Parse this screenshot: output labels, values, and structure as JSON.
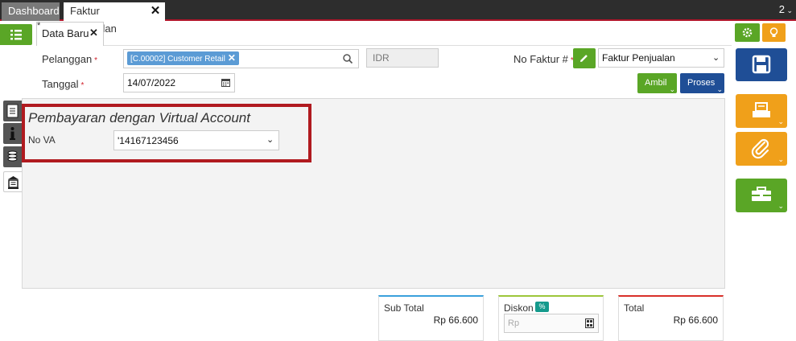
{
  "window": {
    "count": "2"
  },
  "tabs": [
    {
      "label": "Dashboard"
    },
    {
      "label": "Faktur Penjualan"
    }
  ],
  "subtab": {
    "label": "Data Baru",
    "modified_marker": "*"
  },
  "form": {
    "pelanggan_label": "Pelanggan",
    "pelanggan_value": "[C.00002] Customer Retail",
    "currency": "IDR",
    "tanggal_label": "Tanggal",
    "tanggal_value": "14/07/2022",
    "required_marker": "*",
    "no_faktur_label": "No Faktur #",
    "faktur_type": "Faktur Penjualan"
  },
  "actions": {
    "ambil": "Ambil",
    "proses": "Proses"
  },
  "va": {
    "title": "Pembayaran dengan Virtual Account",
    "label": "No VA",
    "value": "'14167123456"
  },
  "totals": {
    "subtotal_label": "Sub Total",
    "subtotal_value": "Rp 66.600",
    "diskon_label": "Diskon",
    "diskon_badge": "%",
    "diskon_placeholder": "Rp",
    "total_label": "Total",
    "total_value": "Rp 66.600"
  },
  "colors": {
    "green": "#5aa626",
    "orange": "#f0a01a",
    "blue": "#1f4e96",
    "red": "#b01a1f",
    "teal": "#159a8c"
  }
}
